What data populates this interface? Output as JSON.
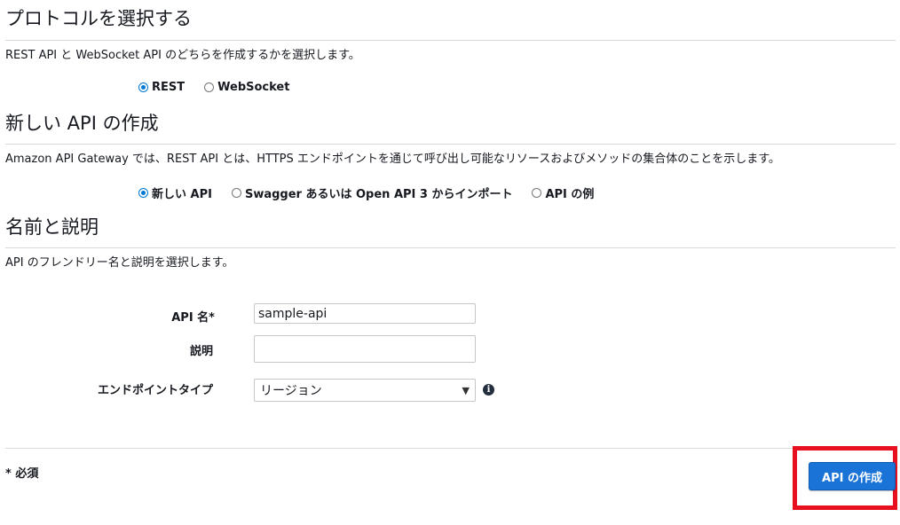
{
  "protocol": {
    "title": "プロトコルを選択する",
    "description": "REST API と WebSocket API のどちらを作成するかを選択します。",
    "options": [
      "REST",
      "WebSocket"
    ],
    "selected": "REST"
  },
  "new_api": {
    "title": "新しい API の作成",
    "description": "Amazon API Gateway では、REST API とは、HTTPS エンドポイントを通じて呼び出し可能なリソースおよびメソッドの集合体のことを示します。",
    "options": [
      "新しい API",
      "Swagger あるいは Open API 3 からインポート",
      "API の例"
    ],
    "selected": "新しい API"
  },
  "name_desc": {
    "title": "名前と説明",
    "description": "API のフレンドリー名と説明を選択します。",
    "api_name_label": "API 名*",
    "api_name_value": "sample-api",
    "description_label": "説明",
    "description_value": "",
    "endpoint_type_label": "エンドポイントタイプ",
    "endpoint_type_value": "リージョン"
  },
  "footer": {
    "required_note": "* 必須",
    "create_button": "API の作成"
  },
  "colors": {
    "accent": "#1a73d6",
    "highlight": "#e8101e"
  }
}
